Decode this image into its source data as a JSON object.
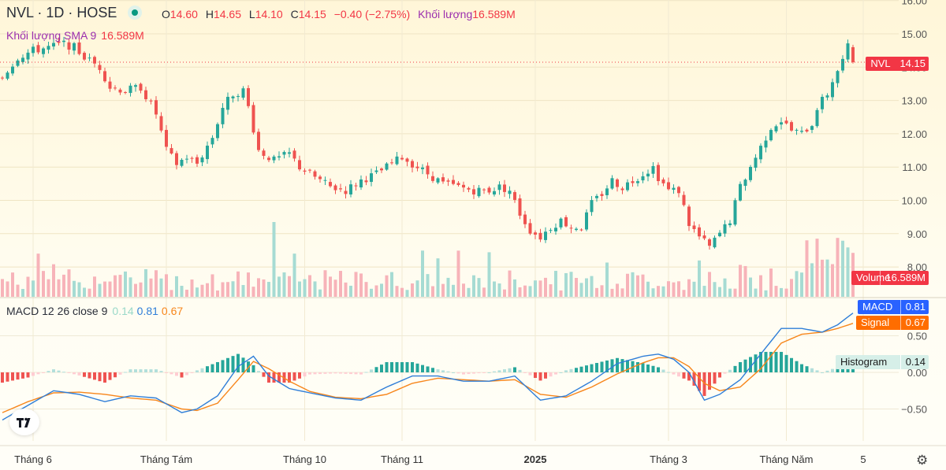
{
  "header": {
    "symbol": "NVL · 1D · HOSE",
    "ohlc_labels": [
      "O",
      "H",
      "L",
      "C"
    ],
    "open": "14.60",
    "high": "14.65",
    "low": "14.10",
    "close": "14.15",
    "change": "−0.40 (−2.75%)",
    "volume_label": "Khối lượng",
    "volume": "16.589M"
  },
  "volume_sma": {
    "label": "Khối lượng SMA 9",
    "value": "16.589M"
  },
  "macd_legend": {
    "label": "MACD 12 26 close 9",
    "histogram": "0.14",
    "macd": "0.81",
    "signal": "0.67"
  },
  "badges": {
    "price": {
      "name": "NVL",
      "value": "14.15"
    },
    "volume": {
      "name": "Volume",
      "value": "16.589M"
    },
    "macd": {
      "name": "MACD",
      "value": "0.81"
    },
    "signal": {
      "name": "Signal",
      "value": "0.67"
    },
    "histogram": {
      "name": "Histogram",
      "value": "0.14"
    }
  },
  "colors": {
    "up": "#26a69a",
    "down": "#ef5350",
    "macd": "#2f7ed8",
    "signal": "#f7861b"
  },
  "icons": {
    "logo": "tradingview-logo-icon",
    "settings": "gear-icon"
  },
  "chart_data": {
    "type": "candlestick",
    "price_axis": {
      "ticks": [
        "16.00",
        "15.00",
        "14.00",
        "13.00",
        "12.00",
        "11.00",
        "10.00",
        "9.00",
        "8.00"
      ],
      "ylim": [
        7.0,
        16.0
      ]
    },
    "macd_axis": {
      "ticks": [
        "0.50",
        "0.00",
        "−0.50"
      ],
      "ylim": [
        -0.9,
        1.0
      ]
    },
    "x_ticks": [
      "Tháng 6",
      "Tháng Tám",
      "Tháng 10",
      "Tháng 11",
      "2025",
      "Tháng 3",
      "Tháng Năm",
      "5"
    ],
    "last_close": 14.15,
    "close_path": [
      [
        0,
        13.7
      ],
      [
        3,
        14.3
      ],
      [
        6,
        14.5
      ],
      [
        9,
        14.6
      ],
      [
        12,
        14.7
      ],
      [
        14,
        14.6
      ],
      [
        16,
        14.3
      ],
      [
        19,
        14.0
      ],
      [
        21,
        13.4
      ],
      [
        24,
        13.3
      ],
      [
        27,
        13.4
      ],
      [
        30,
        12.6
      ],
      [
        32,
        11.5
      ],
      [
        34,
        11.1
      ],
      [
        36,
        11.3
      ],
      [
        38,
        11.1
      ],
      [
        41,
        11.9
      ],
      [
        43,
        12.8
      ],
      [
        45,
        13.2
      ],
      [
        47,
        13.3
      ],
      [
        48,
        12.8
      ],
      [
        50,
        11.5
      ],
      [
        53,
        11.2
      ],
      [
        56,
        11.4
      ],
      [
        58,
        11.0
      ],
      [
        61,
        10.7
      ],
      [
        64,
        10.4
      ],
      [
        67,
        10.3
      ],
      [
        70,
        10.6
      ],
      [
        73,
        10.8
      ],
      [
        76,
        11.1
      ],
      [
        78,
        11.3
      ],
      [
        80,
        11.1
      ],
      [
        83,
        10.8
      ],
      [
        86,
        10.5
      ],
      [
        89,
        10.4
      ],
      [
        92,
        10.3
      ],
      [
        95,
        10.3
      ],
      [
        97,
        10.4
      ],
      [
        99,
        10.3
      ],
      [
        101,
        9.6
      ],
      [
        103,
        9.1
      ],
      [
        105,
        8.9
      ],
      [
        107,
        9.2
      ],
      [
        109,
        9.4
      ],
      [
        111,
        9.2
      ],
      [
        113,
        9.2
      ],
      [
        115,
        9.9
      ],
      [
        117,
        10.2
      ],
      [
        119,
        10.6
      ],
      [
        121,
        10.4
      ],
      [
        123,
        10.6
      ],
      [
        125,
        10.8
      ],
      [
        127,
        11.0
      ],
      [
        128,
        10.7
      ],
      [
        130,
        10.3
      ],
      [
        132,
        10.3
      ],
      [
        134,
        9.3
      ],
      [
        136,
        8.9
      ],
      [
        138,
        8.6
      ],
      [
        140,
        9.0
      ],
      [
        142,
        9.4
      ],
      [
        144,
        10.4
      ],
      [
        146,
        11.0
      ],
      [
        148,
        11.6
      ],
      [
        150,
        12.2
      ],
      [
        152,
        12.4
      ],
      [
        154,
        12.1
      ],
      [
        156,
        12.0
      ],
      [
        158,
        12.3
      ],
      [
        159,
        12.8
      ],
      [
        161,
        13.2
      ],
      [
        162,
        13.6
      ],
      [
        164,
        14.2
      ],
      [
        165,
        14.6
      ],
      [
        166,
        14.15
      ]
    ],
    "macd_path": [
      [
        0,
        -0.65
      ],
      [
        5,
        -0.45
      ],
      [
        10,
        -0.25
      ],
      [
        15,
        -0.3
      ],
      [
        20,
        -0.4
      ],
      [
        25,
        -0.32
      ],
      [
        30,
        -0.35
      ],
      [
        35,
        -0.55
      ],
      [
        38,
        -0.5
      ],
      [
        42,
        -0.32
      ],
      [
        46,
        0.08
      ],
      [
        49,
        0.22
      ],
      [
        52,
        -0.05
      ],
      [
        56,
        -0.22
      ],
      [
        60,
        -0.28
      ],
      [
        65,
        -0.35
      ],
      [
        70,
        -0.38
      ],
      [
        75,
        -0.2
      ],
      [
        80,
        -0.05
      ],
      [
        85,
        -0.05
      ],
      [
        90,
        -0.12
      ],
      [
        95,
        -0.12
      ],
      [
        100,
        -0.05
      ],
      [
        105,
        -0.38
      ],
      [
        110,
        -0.32
      ],
      [
        115,
        -0.12
      ],
      [
        120,
        0.12
      ],
      [
        125,
        0.22
      ],
      [
        128,
        0.25
      ],
      [
        131,
        0.18
      ],
      [
        134,
        0.0
      ],
      [
        137,
        -0.38
      ],
      [
        140,
        -0.3
      ],
      [
        144,
        -0.1
      ],
      [
        148,
        0.25
      ],
      [
        152,
        0.6
      ],
      [
        156,
        0.6
      ],
      [
        160,
        0.55
      ],
      [
        163,
        0.65
      ],
      [
        166,
        0.81
      ]
    ],
    "signal_path": [
      [
        0,
        -0.55
      ],
      [
        5,
        -0.4
      ],
      [
        10,
        -0.28
      ],
      [
        15,
        -0.27
      ],
      [
        20,
        -0.3
      ],
      [
        25,
        -0.35
      ],
      [
        30,
        -0.38
      ],
      [
        35,
        -0.5
      ],
      [
        38,
        -0.52
      ],
      [
        42,
        -0.42
      ],
      [
        46,
        -0.1
      ],
      [
        49,
        0.15
      ],
      [
        52,
        0.05
      ],
      [
        56,
        -0.12
      ],
      [
        60,
        -0.26
      ],
      [
        65,
        -0.34
      ],
      [
        70,
        -0.36
      ],
      [
        75,
        -0.3
      ],
      [
        80,
        -0.15
      ],
      [
        85,
        -0.08
      ],
      [
        90,
        -0.1
      ],
      [
        95,
        -0.12
      ],
      [
        100,
        -0.1
      ],
      [
        105,
        -0.3
      ],
      [
        110,
        -0.34
      ],
      [
        115,
        -0.2
      ],
      [
        120,
        -0.02
      ],
      [
        125,
        0.13
      ],
      [
        128,
        0.2
      ],
      [
        131,
        0.2
      ],
      [
        134,
        0.08
      ],
      [
        137,
        -0.15
      ],
      [
        140,
        -0.25
      ],
      [
        144,
        -0.2
      ],
      [
        148,
        0.05
      ],
      [
        152,
        0.4
      ],
      [
        156,
        0.52
      ],
      [
        160,
        0.55
      ],
      [
        163,
        0.6
      ],
      [
        166,
        0.67
      ]
    ]
  }
}
